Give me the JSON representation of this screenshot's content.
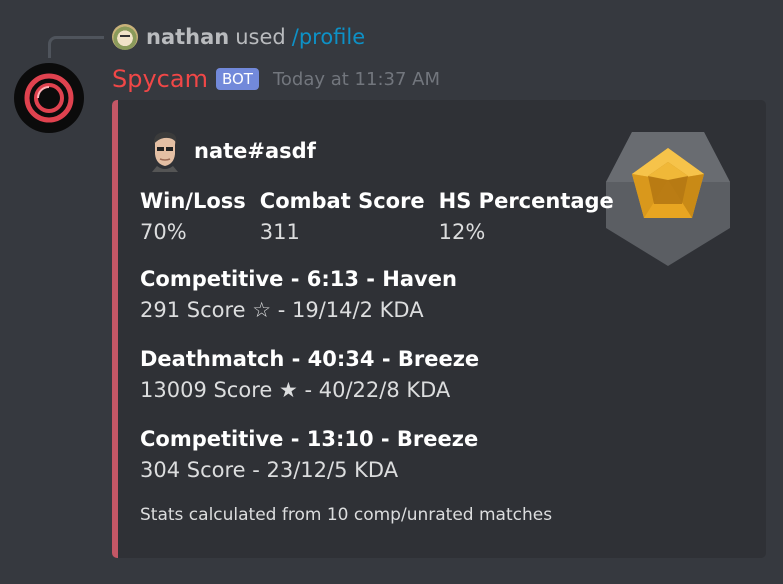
{
  "reply": {
    "user": "nathan",
    "used_text": "used",
    "command": "/profile"
  },
  "message": {
    "bot_name": "Spycam",
    "bot_tag": "BOT",
    "timestamp": "Today at 11:37 AM",
    "name_color": "#f04747"
  },
  "embed": {
    "accent_color": "#c45766",
    "author_name": "nate#asdf",
    "thumbnail_icon": "rank-badge-icon",
    "stats": [
      {
        "name": "Win/Loss",
        "value": "70%"
      },
      {
        "name": "Combat Score",
        "value": "311"
      },
      {
        "name": "HS Percentage",
        "value": "12%"
      }
    ],
    "matches": [
      {
        "title": "Competitive - 6:13 - Haven",
        "detail": "291 Score ☆ - 19/14/2 KDA"
      },
      {
        "title": "Deathmatch - 40:34 - Breeze",
        "detail": "13009 Score ★ - 40/22/8 KDA"
      },
      {
        "title": "Competitive - 13:10 - Breeze",
        "detail": "304 Score - 23/12/5 KDA"
      }
    ],
    "footer": "Stats calculated from 10 comp/unrated matches"
  }
}
